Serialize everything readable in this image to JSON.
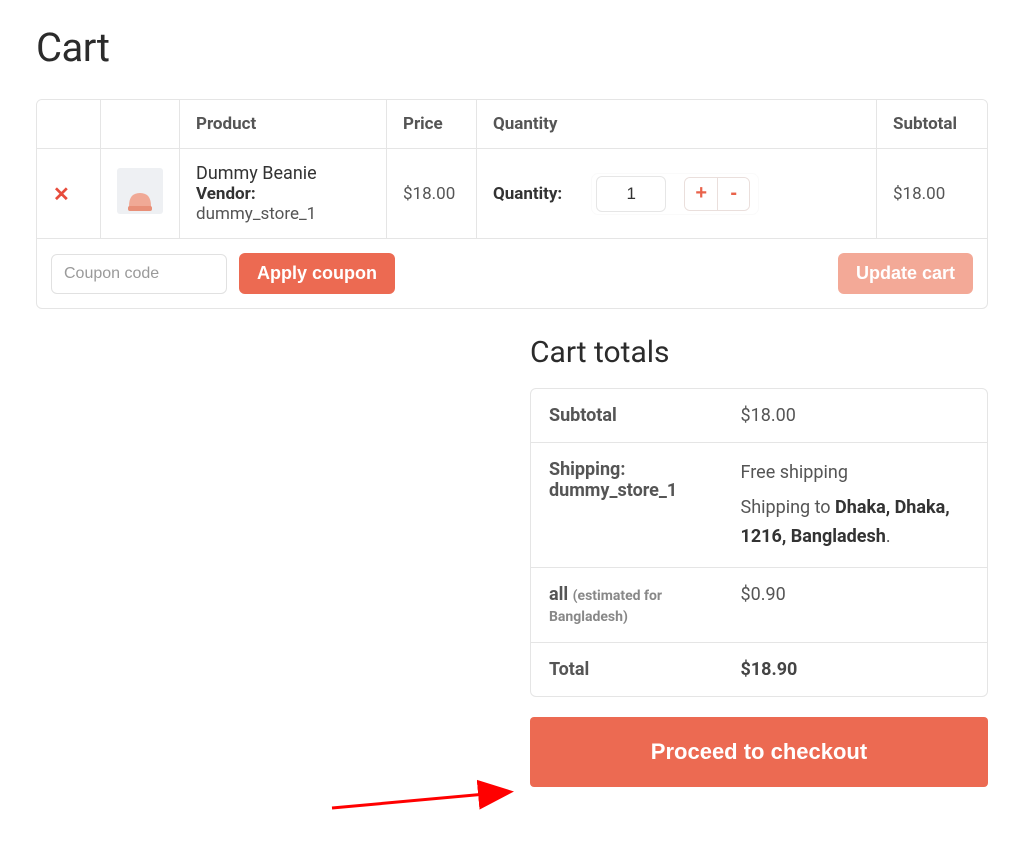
{
  "page": {
    "title": "Cart"
  },
  "tableHeaders": {
    "product": "Product",
    "price": "Price",
    "quantity": "Quantity",
    "subtotal": "Subtotal"
  },
  "cart": {
    "items": [
      {
        "name": "Dummy Beanie",
        "vendorLabel": "Vendor:",
        "vendor": "dummy_store_1",
        "price": "$18.00",
        "qtyLabel": "Quantity:",
        "quantity": "1",
        "subtotal": "$18.00"
      }
    ],
    "coupon": {
      "placeholder": "Coupon code",
      "applyLabel": "Apply coupon"
    },
    "updateLabel": "Update cart"
  },
  "totals": {
    "title": "Cart totals",
    "subtotalLabel": "Subtotal",
    "subtotal": "$18.00",
    "shippingLabelPrefix": "Shipping:",
    "shippingStore": "dummy_store_1",
    "shippingMethod": "Free shipping",
    "shippingToPrefix": "Shipping to ",
    "shippingDestination": "Dhaka, Dhaka, 1216, Bangladesh",
    "shippingToSuffix": ".",
    "taxLabel": "all",
    "taxNote": "(estimated for Bangladesh)",
    "tax": "$0.90",
    "totalLabel": "Total",
    "total": "$18.90",
    "checkoutLabel": "Proceed to checkout"
  },
  "colors": {
    "accent": "#ec6a52"
  }
}
